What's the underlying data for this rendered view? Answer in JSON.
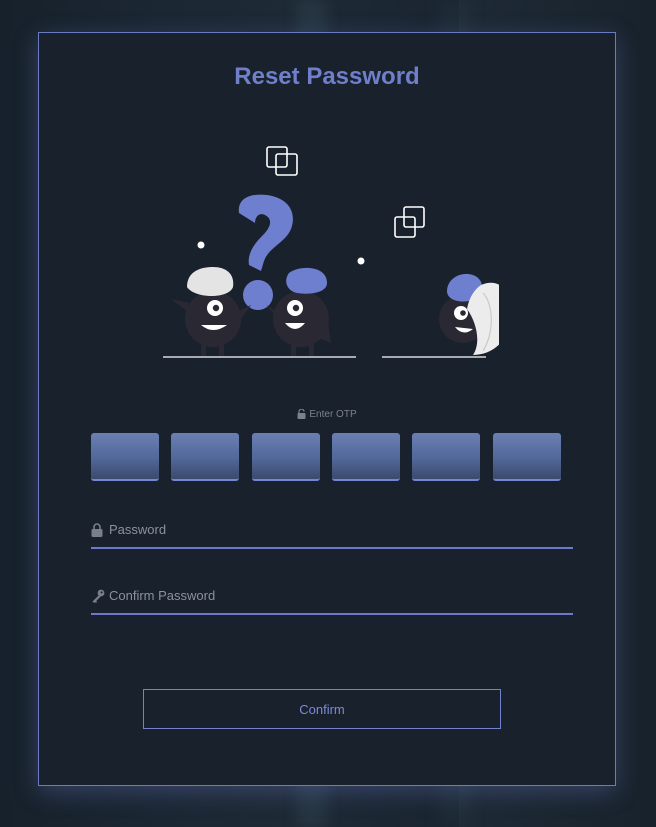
{
  "page": {
    "title": "Reset Password"
  },
  "otp": {
    "label": "Enter OTP",
    "digits": [
      "",
      "",
      "",
      "",
      "",
      ""
    ]
  },
  "form": {
    "password_placeholder": "Password",
    "confirm_password_placeholder": "Confirm Password",
    "confirm_label": "Confirm"
  },
  "icons": {
    "otp": "lock-icon",
    "password": "lock-icon",
    "confirm_password": "key-icon"
  },
  "colors": {
    "accent": "#6f7fc9",
    "card_border": "#6a7bc2",
    "otp_box_top": "#6a80b4",
    "otp_box_bottom": "#3b4a6d",
    "field_underline": "#6b78cc"
  }
}
